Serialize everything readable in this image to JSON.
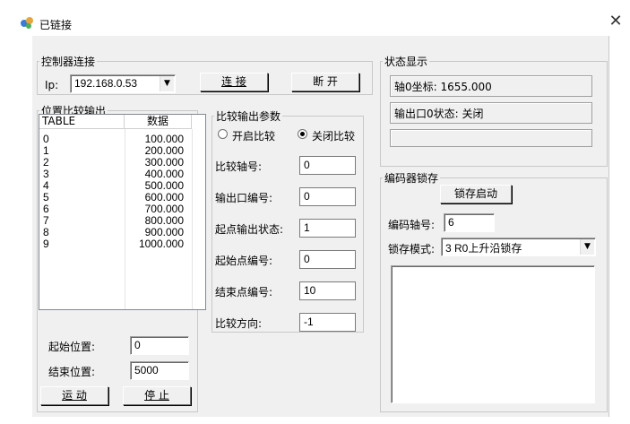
{
  "window": {
    "title": "已链接",
    "close_glyph": "✕",
    "app_icon": "app-icon"
  },
  "controller": {
    "group_label": "控制器连接",
    "ip_label": "Ip:",
    "ip_value": "192.168.0.53",
    "connect_label": "连 接",
    "disconnect_label": "断 开"
  },
  "compare_output": {
    "group_label": "位置比较输出",
    "columns": [
      "TABLE",
      "数据"
    ],
    "rows": [
      [
        "0",
        "100.000"
      ],
      [
        "1",
        "200.000"
      ],
      [
        "2",
        "300.000"
      ],
      [
        "3",
        "400.000"
      ],
      [
        "4",
        "500.000"
      ],
      [
        "5",
        "600.000"
      ],
      [
        "6",
        "700.000"
      ],
      [
        "7",
        "800.000"
      ],
      [
        "8",
        "900.000"
      ],
      [
        "9",
        "1000.000"
      ]
    ],
    "start_pos_label": "起始位置:",
    "start_pos_value": "0",
    "end_pos_label": "结束位置:",
    "end_pos_value": "5000",
    "move_label": "运 动",
    "stop_label": "停 止"
  },
  "compare_params": {
    "group_label": "比较输出参数",
    "enable_label": "开启比较",
    "disable_label": "关闭比较",
    "selected": "disable",
    "axis_label": "比较轴号:",
    "axis_value": "0",
    "output_label": "输出口编号:",
    "output_value": "0",
    "start_state_label": "起点输出状态:",
    "start_state_value": "1",
    "start_point_label": "起始点编号:",
    "start_point_value": "0",
    "end_point_label": "结束点编号:",
    "end_point_value": "10",
    "direction_label": "比较方向:",
    "direction_value": "-1"
  },
  "status": {
    "group_label": "状态显示",
    "axis0_coord": "轴0坐标: 1655.000",
    "output0_state": "输出口0状态: 关闭",
    "extra": ""
  },
  "encoder_latch": {
    "group_label": "编码器锁存",
    "start_label": "锁存启动",
    "axis_label": "编码轴号:",
    "axis_value": "6",
    "mode_label": "锁存模式:",
    "mode_value": "3 R0上升沿锁存"
  }
}
